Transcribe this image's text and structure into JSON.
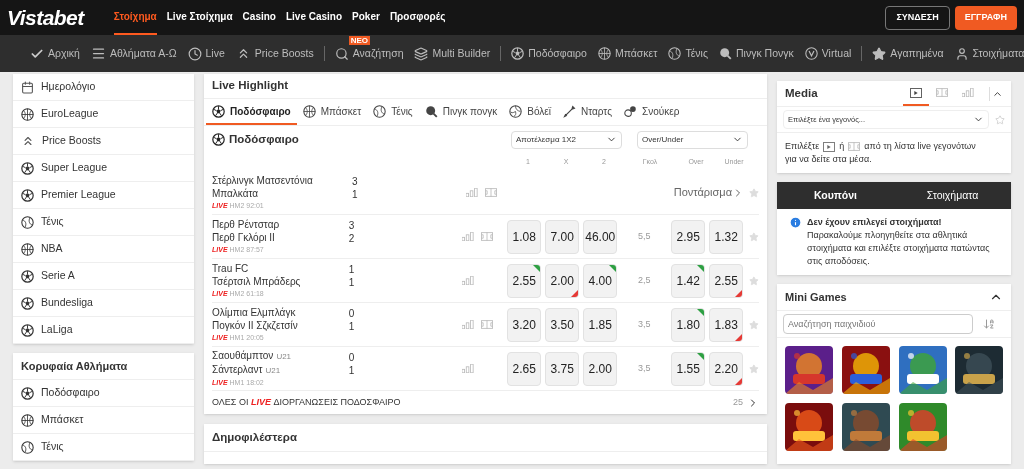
{
  "header": {
    "logo": "Vistabet",
    "menu": [
      {
        "label": "Στοίχημα",
        "selected": true
      },
      {
        "label": "Live Στοίχημα",
        "selected": false
      },
      {
        "label": "Casino",
        "selected": false
      },
      {
        "label": "Live Casino",
        "selected": false
      },
      {
        "label": "Poker",
        "selected": false
      },
      {
        "label": "Προσφορές",
        "selected": false
      }
    ],
    "login": "ΣΥΝΔΕΣΗ",
    "register": "ΕΓΓΡΑΦΗ"
  },
  "nav": {
    "groups": [
      [
        {
          "label": "Αρχική"
        },
        {
          "label": "Αθλήματα Α-Ω"
        },
        {
          "label": "Live"
        },
        {
          "label": "Price Boosts"
        }
      ],
      [
        {
          "label": "Αναζήτηση",
          "badge": "ΝΕΟ"
        },
        {
          "label": "Multi Builder"
        }
      ],
      [
        {
          "label": "Ποδόσφαιρο"
        },
        {
          "label": "Μπάσκετ"
        },
        {
          "label": "Τένις"
        },
        {
          "label": "Πινγκ Πονγκ"
        },
        {
          "label": "Virtual"
        }
      ],
      [
        {
          "label": "Αγαπημένα"
        },
        {
          "label": "Στοιχήματα"
        }
      ]
    ]
  },
  "sidebar": {
    "items": [
      "Ημερολόγιο",
      "EuroLeague",
      "Price Boosts",
      "Super League",
      "Premier League",
      "Τένις",
      "NBA",
      "Serie A",
      "Bundesliga",
      "LaLiga"
    ],
    "top_sports": {
      "title": "Κορυφαία Αθλήματα",
      "items": [
        "Ποδόσφαιρο",
        "Μπάσκετ",
        "Τένις"
      ]
    }
  },
  "live_highlight": {
    "title": "Live Highlight",
    "tabs": [
      {
        "label": "Ποδόσφαιρο",
        "selected": true
      },
      {
        "label": "Μπάσκετ",
        "selected": false
      },
      {
        "label": "Τένις",
        "selected": false
      },
      {
        "label": "Πινγκ πονγκ",
        "selected": false
      },
      {
        "label": "Βόλεϊ",
        "selected": false
      },
      {
        "label": "Νταρτς",
        "selected": false
      },
      {
        "label": "Σνούκερ",
        "selected": false
      }
    ],
    "section": "Ποδόσφαιρο",
    "market_1": "Αποτέλεσμα 1X2",
    "market_2": "Over/Under",
    "columns": [
      "1",
      "X",
      "2",
      "Γκολ",
      "Over",
      "Under"
    ],
    "matches": [
      {
        "kind": "closed",
        "home": "Στέρλινγκ Ματσεντόνια",
        "away": "Μπαλκάτα",
        "home_score": "3",
        "away_score": "1",
        "live": "LIVE",
        "time": "HM2 92:01",
        "field": true,
        "bet_label": "Ποντάρισμα"
      },
      {
        "kind": "odds",
        "home": "Περθ Ρέντσταρ",
        "away": "Περθ Γκλόρι II",
        "home_score": "3",
        "away_score": "2",
        "live": "LIVE",
        "time": "HM2 87:57",
        "field": true,
        "odds": [
          {
            "value": "1.08",
            "up": false,
            "down": false
          },
          {
            "value": "7.00",
            "up": false,
            "down": false
          },
          {
            "value": "46.00",
            "up": false,
            "down": false
          }
        ],
        "goals": "5,5",
        "ou": [
          {
            "value": "2.95",
            "up": false,
            "down": false
          },
          {
            "value": "1.32",
            "up": false,
            "down": false
          }
        ]
      },
      {
        "kind": "odds",
        "home": "Trau FC",
        "away": "Τσέρτσιλ Μπράδερς",
        "home_score": "1",
        "away_score": "1",
        "live": "LIVE",
        "time": "HM2 61:18",
        "field": false,
        "odds": [
          {
            "value": "2.55",
            "up": true,
            "down": false
          },
          {
            "value": "2.00",
            "up": false,
            "down": true
          },
          {
            "value": "4.00",
            "up": true,
            "down": false
          }
        ],
        "goals": "2,5",
        "ou": [
          {
            "value": "1.42",
            "up": true,
            "down": false
          },
          {
            "value": "2.55",
            "up": false,
            "down": true
          }
        ]
      },
      {
        "kind": "odds",
        "home": "Ολίμπια Ελμπλάγκ",
        "away": "Πογκόν II Σζκζετσίν",
        "home_score": "0",
        "away_score": "1",
        "live": "LIVE",
        "time": "HM1 20:05",
        "field": true,
        "odds": [
          {
            "value": "3.20",
            "up": false,
            "down": false
          },
          {
            "value": "3.50",
            "up": false,
            "down": false
          },
          {
            "value": "1.85",
            "up": false,
            "down": false
          }
        ],
        "goals": "3,5",
        "ou": [
          {
            "value": "1.80",
            "up": true,
            "down": false
          },
          {
            "value": "1.83",
            "up": false,
            "down": true
          }
        ]
      },
      {
        "kind": "odds",
        "home": "Σαουθάμπτον",
        "home_tag": "U21",
        "away": "Σάντερλαντ",
        "away_tag": "U21",
        "home_score": "0",
        "away_score": "1",
        "live": "LIVE",
        "time": "HM1 18:02",
        "field": false,
        "odds": [
          {
            "value": "2.65",
            "up": false,
            "down": false
          },
          {
            "value": "3.75",
            "up": false,
            "down": false
          },
          {
            "value": "2.00",
            "up": false,
            "down": false
          }
        ],
        "goals": "3,5",
        "ou": [
          {
            "value": "1.55",
            "up": true,
            "down": false
          },
          {
            "value": "2.20",
            "up": false,
            "down": true
          }
        ]
      }
    ],
    "footer": "ΟΛΕΣ ΟΙ **LIVE** ΔΙΟΡΓΑΝΩΣΕΙΣ ΠΟΔΟΣΦΑΙΡΟ",
    "footer_count": "25"
  },
  "popular": {
    "title": "Δημοφιλέστερα"
  },
  "media": {
    "title": "Media",
    "tabs": [
      {
        "selected": true
      },
      {
        "selected": false
      },
      {
        "selected": false
      }
    ],
    "select_placeholder": "Επιλέξτε ένα γεγονός...",
    "hint_1": "Επιλέξτε",
    "hint_2": "ή",
    "hint_3": "από τη λίστα live γεγονότων",
    "hint_4": "για να δείτε στα μέσα."
  },
  "coupon": {
    "tabs": [
      {
        "label": "Κουπόνι",
        "selected": true
      },
      {
        "label": "Στοιχήματα",
        "selected": false
      }
    ],
    "title": "Δεν έχουν επιλεγεί στοιχήματα!",
    "text": "Παρακαλούμε πλοηγηθείτε στα αθλητικά στοιχήματα και επιλέξτε στοιχήματα πατώντας στις αποδόσεις."
  },
  "mini_games": {
    "title": "Mini Games",
    "search_placeholder": "Αναζήτηση παιχνιδιού"
  }
}
